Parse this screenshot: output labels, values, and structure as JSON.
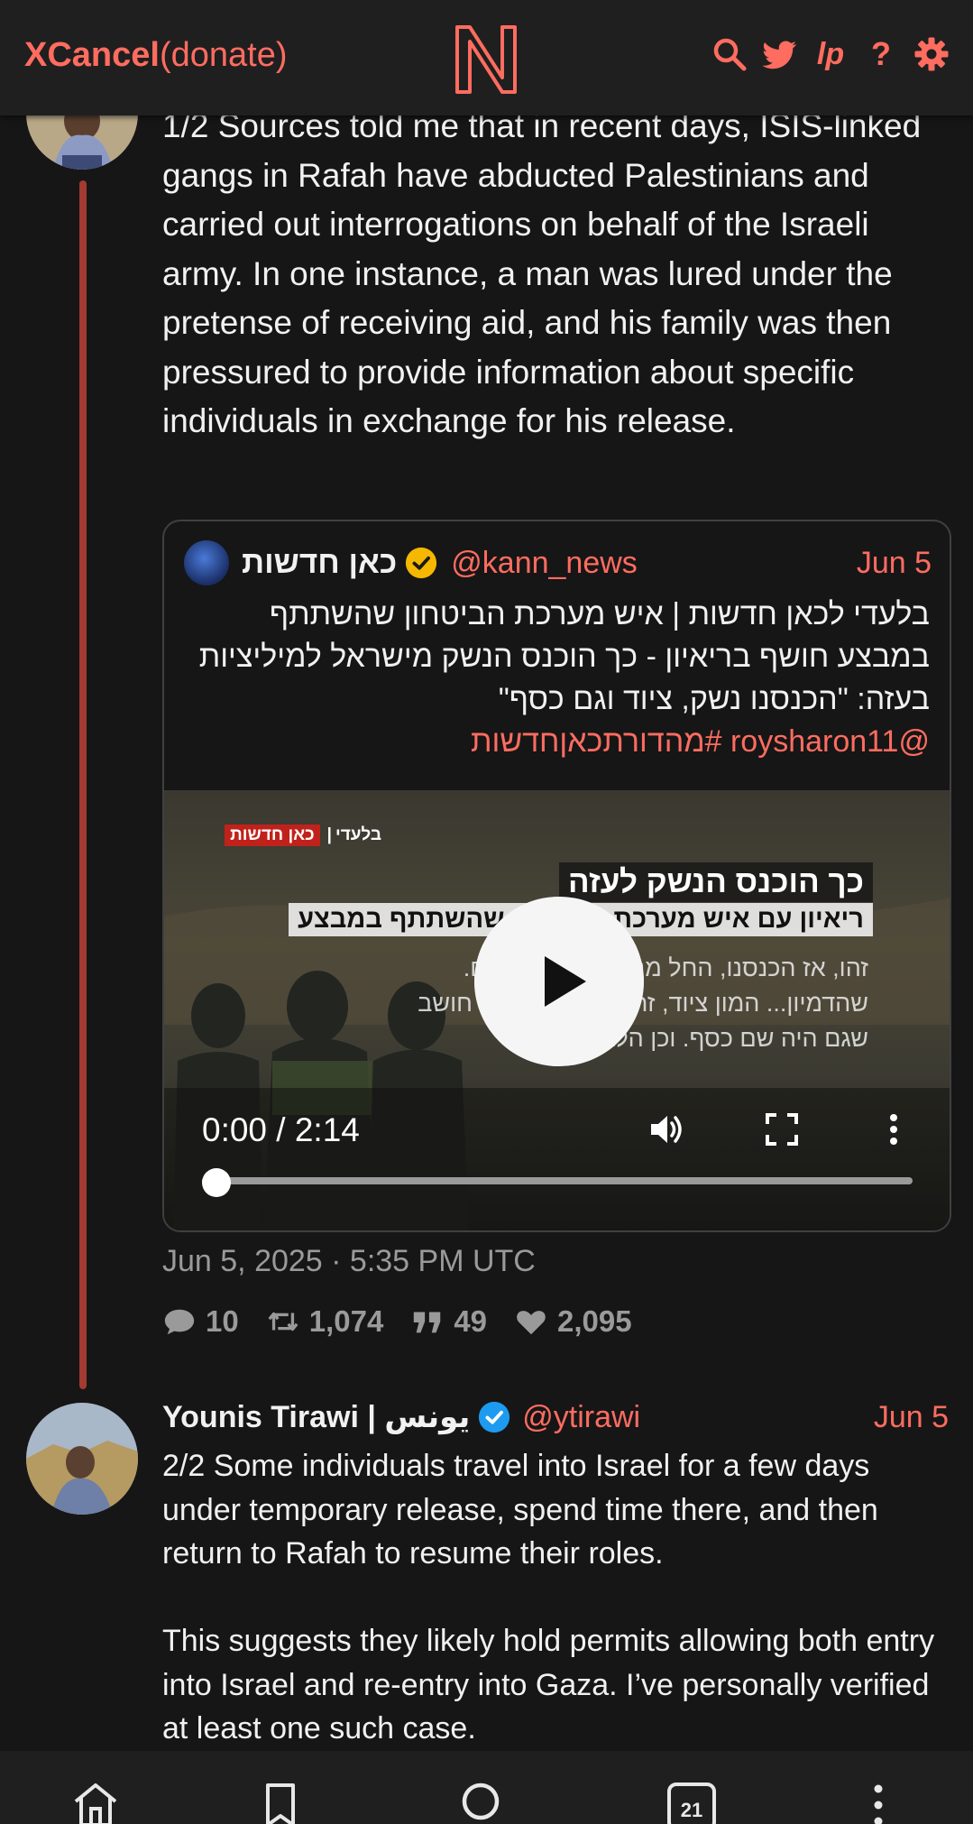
{
  "navbar": {
    "brand_name": "XCancel",
    "donate_label": "(donate)",
    "icons": [
      "search-icon",
      "twitter-bird-icon",
      "liberapay-icon",
      "help-icon",
      "gear-icon"
    ],
    "help_label": "?",
    "liberapay_label": "lp"
  },
  "tweet1": {
    "text": "1/2 Sources told me that in recent days, ISIS-linked gangs in Rafah have abducted Palestinians and carried out interrogations on behalf of the Israeli army. In one instance, a man was lured under the pretense of receiving aid, and his family was then pressured to provide information about specific individuals in exchange for his release.",
    "quote": {
      "name": "כאן חדשות",
      "handle": "@kann_news",
      "date": "Jun 5",
      "text": "בלעדי לכאן חדשות | איש מערכת הביטחון שהשתתף במבצע חושף בריאיון - כך הוכנס הנשק מישראל למיליציות בעזה: \"הכנסנו נשק, ציוד וגם כסף\"",
      "tags": "@roysharon11 #מהדורתכאןחדשות",
      "video": {
        "exclusive_label": "בלעדי",
        "channel_box": "כאן חדשות",
        "title": "כך הוכנס הנשק לעזה",
        "subtitle": "ריאיון עם איש מערכת הביטחון שהשתתף במבצע",
        "caption": "זהו, אז הכנסנו, החל מנשק קל, עוד פעם. שהדמיון... המון ציוד, זה לא רק ציוד אני חושב שגם היה שם כסף. וכן הלאה.",
        "time": "0:00 / 2:14",
        "progress": 0
      }
    },
    "timestamp": "Jun 5, 2025 · 5:35 PM UTC",
    "stats": {
      "replies": "10",
      "retweets": "1,074",
      "quotes": "49",
      "likes": "2,095"
    }
  },
  "tweet2": {
    "name": "Younis Tirawi | يونس",
    "handle": "@ytirawi",
    "date": "Jun 5",
    "text": "2/2 Some individuals travel into Israel for a few days under temporary release, spend time there, and then return to Rafah to resume their roles.\n\nThis suggests they likely hold permits allowing both entry into Israel and re-entry into Gaza. I’ve personally verified at least one such case."
  },
  "bottombar": {
    "icons": [
      "home-icon",
      "bookmark-icon",
      "search-icon",
      "calendar-icon",
      "more-vertical-icon"
    ],
    "calendar_day": "21"
  },
  "colors": {
    "accent": "#ff6c60",
    "background": "#161616",
    "bar": "#1f1f1f",
    "thread_line": "#a33a32",
    "verified_gold": "#f5b800",
    "verified_blue": "#1d9bf0"
  }
}
